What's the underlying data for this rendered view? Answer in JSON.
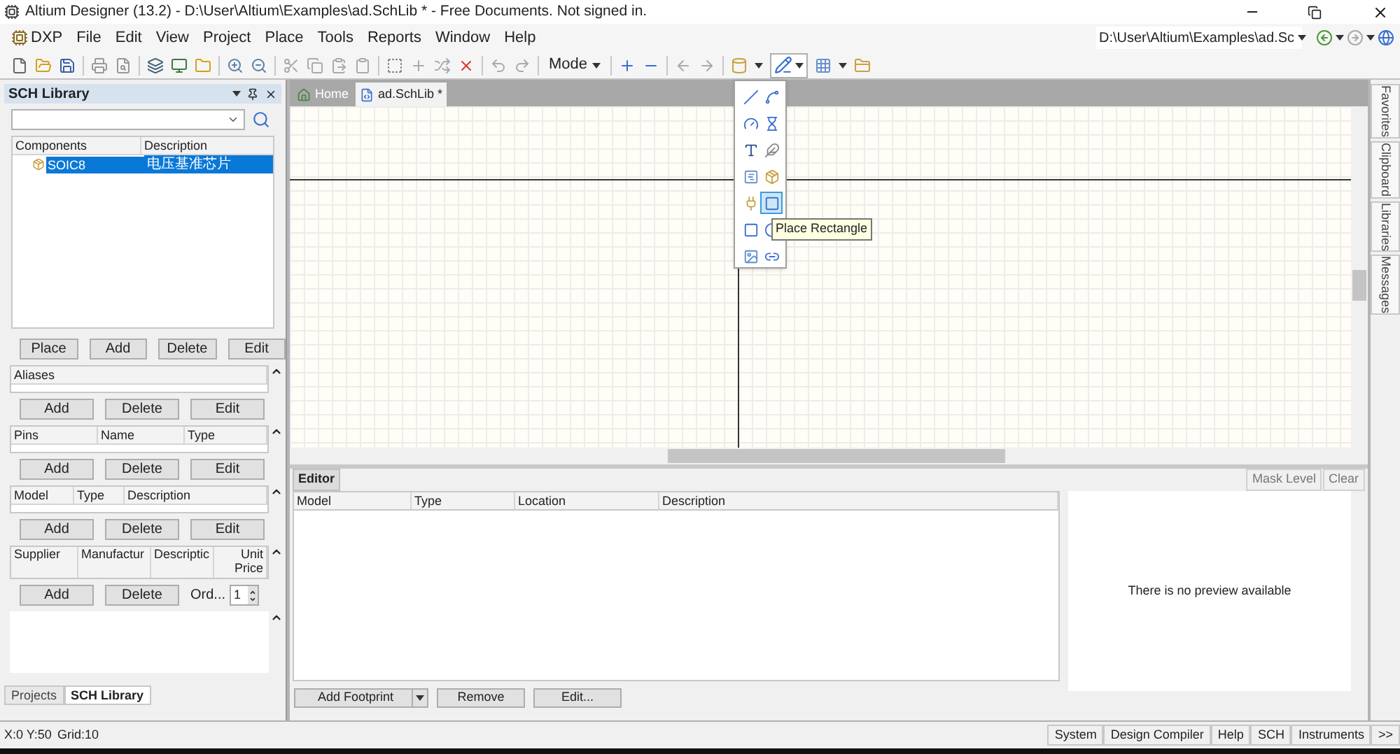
{
  "window": {
    "title": "Altium Designer (13.2) - D:\\User\\Altium\\Examples\\ad.SchLib * - Free Documents. Not signed in."
  },
  "menu": [
    "DXP",
    "File",
    "Edit",
    "View",
    "Project",
    "Place",
    "Tools",
    "Reports",
    "Window",
    "Help"
  ],
  "path_combo": {
    "value": "D:\\User\\Altium\\Examples\\ad.Sc"
  },
  "toolbar": {
    "mode": "Mode"
  },
  "place_menu": {
    "items": [
      {
        "selected": false
      },
      {
        "selected": false
      },
      {
        "selected": false
      },
      {
        "selected": false
      },
      {
        "selected": false
      },
      {
        "selected": false
      },
      {
        "selected": false
      },
      {
        "selected": false
      },
      {
        "selected": false
      },
      {
        "selected": true
      },
      {
        "selected": false
      },
      {
        "selected": false
      },
      {
        "selected": false
      },
      {
        "selected": false
      }
    ],
    "tooltip": "Place Rectangle"
  },
  "left_panel": {
    "title": "SCH Library",
    "components": {
      "columns": [
        "Components",
        "Description"
      ],
      "rows": [
        {
          "name": "SOIC8",
          "description": "电压基准芯片",
          "selected": true
        }
      ],
      "buttons": [
        "Place",
        "Add",
        "Delete",
        "Edit"
      ]
    },
    "aliases": {
      "columns": [
        "Aliases"
      ],
      "buttons": [
        "Add",
        "Delete",
        "Edit"
      ]
    },
    "pins": {
      "columns": [
        "Pins",
        "Name",
        "Type"
      ],
      "buttons": [
        "Add",
        "Delete",
        "Edit"
      ]
    },
    "models": {
      "columns": [
        "Model",
        "Type",
        "Description"
      ],
      "buttons": [
        "Add",
        "Delete",
        "Edit"
      ]
    },
    "suppliers": {
      "columns": [
        "Supplier",
        "Manufactur",
        "Descriptic",
        "Unit Price"
      ],
      "buttons": [
        "Add",
        "Delete"
      ],
      "order_label": "Ord...",
      "order_value": "1"
    },
    "tabs": [
      {
        "label": "Projects",
        "selected": false
      },
      {
        "label": "SCH Library",
        "selected": true
      }
    ]
  },
  "document_tabs": [
    {
      "label": "Home",
      "selected": false
    },
    {
      "label": "ad.SchLib *",
      "selected": true
    }
  ],
  "right_tabs": [
    "Favorites",
    "Clipboard",
    "Libraries",
    "Messages"
  ],
  "editor": {
    "tab": "Editor",
    "actions": [
      "Mask Level",
      "Clear"
    ],
    "columns": [
      "Model",
      "Type",
      "Location",
      "Description"
    ],
    "preview": "There is no preview available",
    "buttons": [
      "Add Footprint",
      "Remove",
      "Edit..."
    ]
  },
  "status_bar": {
    "coords": "X:0 Y:50",
    "grid": "Grid:10",
    "panels": [
      "System",
      "Design Compiler",
      "Help",
      "SCH",
      "Instruments",
      ">>"
    ]
  }
}
